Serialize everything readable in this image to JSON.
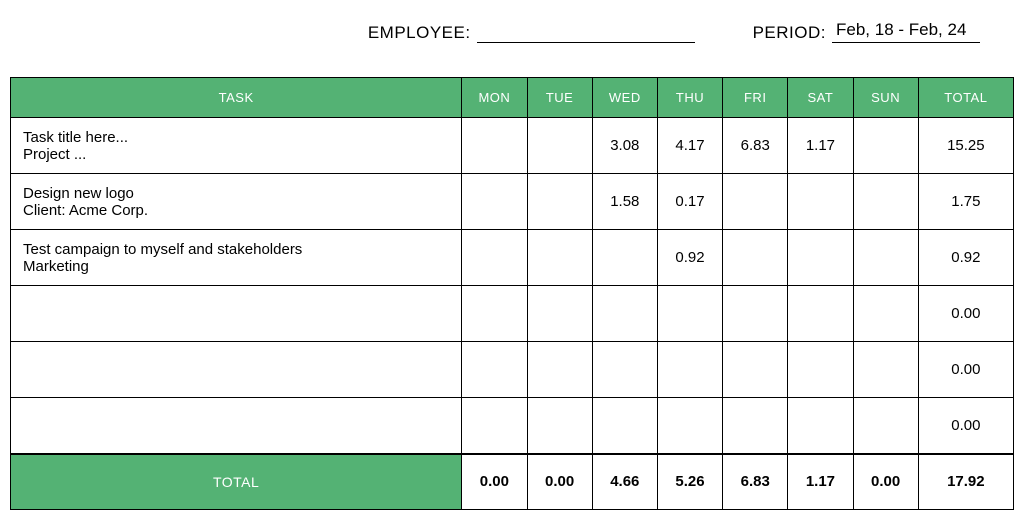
{
  "form": {
    "employee_label": "EMPLOYEE:",
    "employee_value": "",
    "period_label": "PERIOD:",
    "period_value": "Feb, 18 - Feb, 24"
  },
  "columns": {
    "task": "TASK",
    "mon": "MON",
    "tue": "TUE",
    "wed": "WED",
    "thu": "THU",
    "fri": "FRI",
    "sat": "SAT",
    "sun": "SUN",
    "total": "TOTAL"
  },
  "rows": [
    {
      "title": "Task title here...",
      "sub": "Project ...",
      "mon": "",
      "tue": "",
      "wed": "3.08",
      "thu": "4.17",
      "fri": "6.83",
      "sat": "1.17",
      "sun": "",
      "total": "15.25"
    },
    {
      "title": "Design new logo",
      "sub": "Client: Acme Corp.",
      "mon": "",
      "tue": "",
      "wed": "1.58",
      "thu": "0.17",
      "fri": "",
      "sat": "",
      "sun": "",
      "total": "1.75"
    },
    {
      "title": "Test campaign to myself and stakeholders",
      "sub": "Marketing",
      "mon": "",
      "tue": "",
      "wed": "",
      "thu": "0.92",
      "fri": "",
      "sat": "",
      "sun": "",
      "total": "0.92"
    },
    {
      "title": "",
      "sub": "",
      "mon": "",
      "tue": "",
      "wed": "",
      "thu": "",
      "fri": "",
      "sat": "",
      "sun": "",
      "total": "0.00"
    },
    {
      "title": "",
      "sub": "",
      "mon": "",
      "tue": "",
      "wed": "",
      "thu": "",
      "fri": "",
      "sat": "",
      "sun": "",
      "total": "0.00"
    },
    {
      "title": "",
      "sub": "",
      "mon": "",
      "tue": "",
      "wed": "",
      "thu": "",
      "fri": "",
      "sat": "",
      "sun": "",
      "total": "0.00"
    }
  ],
  "totals": {
    "label": "TOTAL",
    "mon": "0.00",
    "tue": "0.00",
    "wed": "4.66",
    "thu": "5.26",
    "fri": "6.83",
    "sat": "1.17",
    "sun": "0.00",
    "total": "17.92"
  }
}
